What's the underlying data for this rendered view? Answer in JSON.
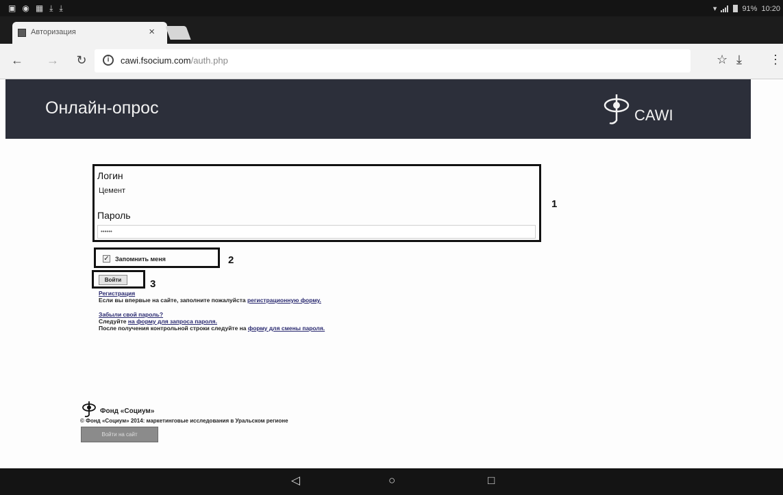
{
  "statusbar": {
    "left_icons": [
      "image-icon",
      "vpn-icon",
      "calendar-icon",
      "download-icon",
      "download-icon"
    ],
    "battery": "91%",
    "time": "10:20"
  },
  "tab": {
    "title": "Авторизация",
    "close": "×"
  },
  "omnibox": {
    "host": "cawi.fsocium.com",
    "path": "/auth.php"
  },
  "site_header": {
    "title": "Онлайн-опрос",
    "logo_text": "CAWI"
  },
  "form": {
    "login_label": "Логин",
    "login_value": "Цемент",
    "password_label": "Пароль",
    "password_value": "••••••",
    "remember_label": "Запомнить меня",
    "remember_checked": true,
    "submit_label": "Войти"
  },
  "annotations": {
    "n1": "1",
    "n2": "2",
    "n3": "3"
  },
  "links": {
    "register_link": "Регистрация",
    "register_text": "Если вы впервые на сайте, заполните пожалуйста ",
    "register_form_link": "регистрационную форму.",
    "forgot_link": "Забыли свой пароль?",
    "forgot_follow": "Следуйте ",
    "forgot_form_link": "на форму для запроса пароля.",
    "after_text": "После получения контрольной строки следуйте на ",
    "change_form_link": "форму для смены пароля."
  },
  "footer": {
    "fond_name": "Фонд «Социум»",
    "copyright": "© Фонд «Социум» 2014: маркетинговые исследования в Уральском регионе",
    "site_button": "Войти на сайт"
  }
}
